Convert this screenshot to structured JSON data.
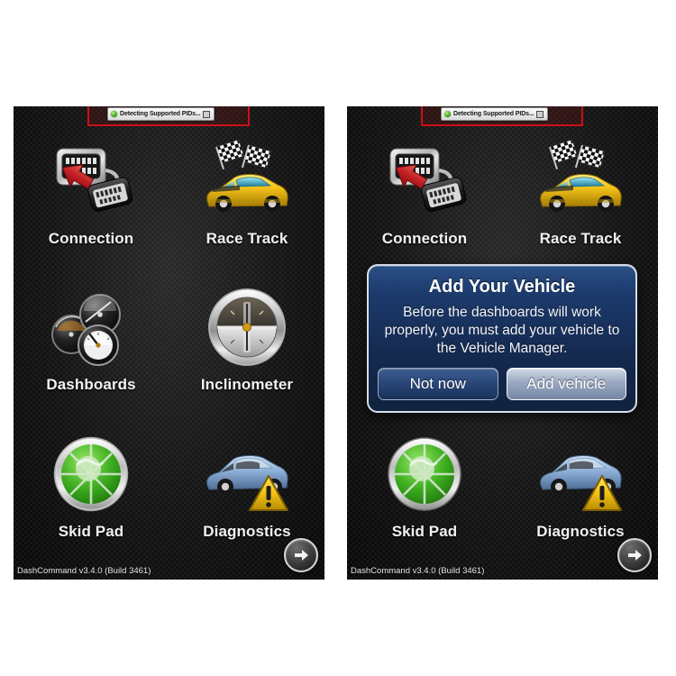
{
  "app": {
    "footer": "DashCommand v3.4.0 (Build 3461)",
    "status_toast": "Detecting Supported PIDs...",
    "accent_red": "#cc1016",
    "dialog_blue": "#1d3b6d"
  },
  "menu": {
    "items": [
      {
        "label": "Connection",
        "icon": "obd-connector-icon"
      },
      {
        "label": "Race Track",
        "icon": "race-car-flags-icon"
      },
      {
        "label": "Dashboards",
        "icon": "gauge-cluster-icon"
      },
      {
        "label": "Inclinometer",
        "icon": "chrome-level-gauge-icon"
      },
      {
        "label": "Skid Pad",
        "icon": "green-skidpad-icon"
      },
      {
        "label": "Diagnostics",
        "icon": "car-warning-icon"
      }
    ]
  },
  "nav": {
    "next_icon": "arrow-right-icon"
  },
  "dialog": {
    "title": "Add Your Vehicle",
    "body": "Before the dashboards will work properly, you must add your vehicle to the Vehicle Manager.",
    "buttons": {
      "secondary": "Not now",
      "primary": "Add vehicle"
    }
  },
  "panels": [
    {
      "name": "home-screen",
      "has_dialog": false
    },
    {
      "name": "home-screen-with-dialog",
      "has_dialog": true
    }
  ]
}
